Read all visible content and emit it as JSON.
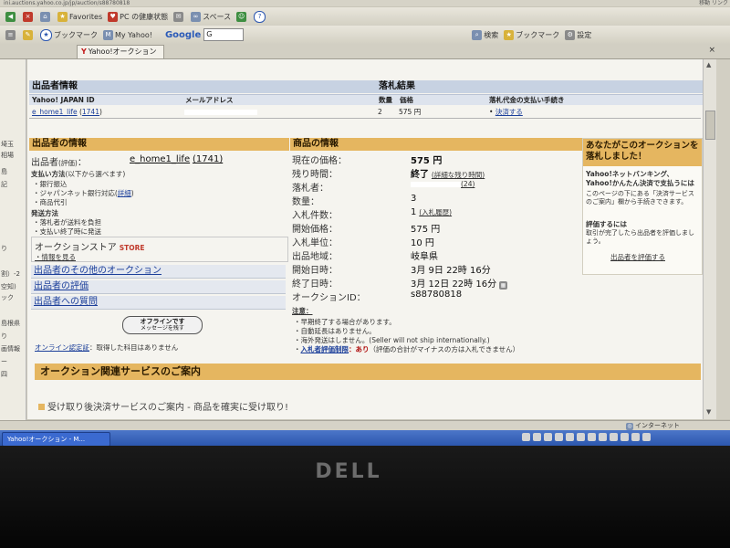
{
  "browser": {
    "url": "ini.auctions.yahoo.co.jp/jp/auction/s88780818",
    "url_right": "移動   リンク",
    "toolbar1": {
      "favorites": "Favorites",
      "pc_health": "PC の健康状態",
      "space": "スペース"
    },
    "toolbar2": {
      "bookmark": "ブックマーク",
      "my_yahoo": "My Yahoo!",
      "google_label": "Google",
      "google_value": "G",
      "search_label": "検索",
      "bookmark2": "ブックマーク",
      "settings": "設定"
    },
    "tab": {
      "label": "Yahoo!オークション"
    },
    "status": {
      "zone": "インターネット"
    },
    "taskbar": {
      "item": "Yahoo!オークション - M..."
    }
  },
  "leftnav": [
    "埼玉",
    "相場",
    "島",
    "記",
    "り",
    "割）-2",
    "空知)",
    "ック",
    "島根県",
    "り",
    "画情報",
    "ー",
    "四"
  ],
  "seller_info": {
    "title": "出品者情報",
    "col_id": "Yahoo! JAPAN ID",
    "col_mail": "メールアドレス",
    "id_value": "e_home1_life",
    "id_count": "1741"
  },
  "result": {
    "title": "落札結果",
    "col_qty": "数量",
    "col_price": "価格",
    "col_payment": "落札代金の支払い手続き",
    "qty": "2",
    "price": "575 円",
    "payment_link": "決済する",
    "bullet": "•"
  },
  "seller_box": {
    "title": "出品者の情報",
    "seller_label": "出品者",
    "rating_label": "(評価)",
    "colon": "：",
    "seller_id": "e_home1_life",
    "seller_rating": "(1741)",
    "payment_head": "支払い方法",
    "payment_note": "(以下から選べます)",
    "payment_items": [
      "・銀行振込",
      "・ジャパンネット銀行対応(",
      "・商品代引"
    ],
    "payment_detail": "詳細",
    "close_paren": ")",
    "shipping_head": "発送方法",
    "shipping_items": [
      "・落札者が送料を負担",
      "・支払い終了時に発送"
    ],
    "store_label": "オークションストア",
    "store_badge": "STORE",
    "store_link": "・情報を見る",
    "links": [
      "出品者のその他のオークション",
      "出品者の評価",
      "出品者への質問"
    ],
    "offline_line1": "オフラインです",
    "offline_line2": "メッセージを残す",
    "online_cert": "オンライン認定証",
    "online_cert_text": "：取得した科目はありません"
  },
  "product": {
    "title": "商品の情報",
    "rows": [
      {
        "label": "現在の価格：",
        "value": "575 円"
      },
      {
        "label": "残り時間：",
        "value": "終了"
      },
      {
        "label": "落札者：",
        "value": ""
      },
      {
        "label": "数量：",
        "value": "3"
      },
      {
        "label": "入札件数：",
        "value": "1"
      },
      {
        "label": "開始価格：",
        "value": "575 円"
      },
      {
        "label": "入札単位：",
        "value": "10 円"
      },
      {
        "label": "出品地域：",
        "value": "岐阜県"
      },
      {
        "label": "開始日時：",
        "value": "3月 9日 22時 16分"
      },
      {
        "label": "終了日時：",
        "value": "3月 12日 22時 16分"
      },
      {
        "label": "オークションID：",
        "value": "s88780818"
      }
    ],
    "remaining_link": "(詳細な残り時間)",
    "bidder_score": "(24)",
    "bid_history": "(入札履歴)",
    "notes_head": "注意：",
    "notes": [
      "・早期終了する場合があります。",
      "・自動延長はありません。",
      "・海外発送はしません。(Seller will not ship internationally.)"
    ],
    "restrict_link": "入札者評価制限",
    "restrict_text": "：あり",
    "restrict_note": "（評価の合計がマイナスの方は入札できません）"
  },
  "notice": {
    "title": "あなたがこのオークションを落札しました！",
    "body1": "Yahoo!ネットバンキング、Yahoo!かんたん決済で支払うには",
    "body2": "このページの下にある「決済サービスのご案内」欄から手続きできます。",
    "rate_head": "評価するには",
    "rate_body": "取引が完了したら出品者を評価しましょう。",
    "rate_link": "出品者を評価する"
  },
  "services": {
    "title": "オークション関連サービスのご案内",
    "teaser": "受け取り後決済サービスのご案内 - 商品を確実に受け取り!"
  },
  "monitor": {
    "brand": "DELL"
  }
}
